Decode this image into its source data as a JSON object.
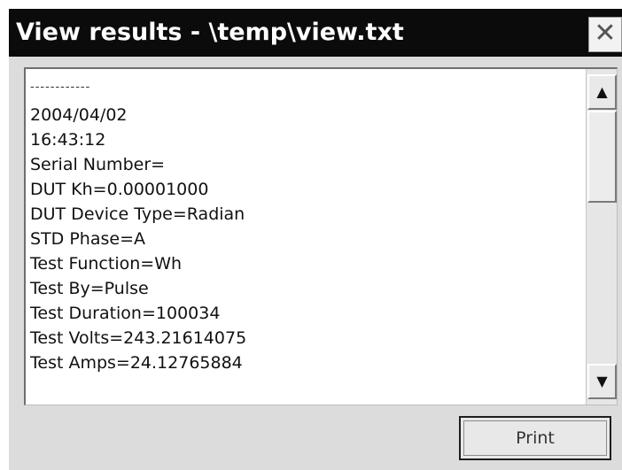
{
  "window": {
    "title": "View results - \\temp\\view.txt",
    "close_glyph": "✕"
  },
  "results": {
    "separator": "------------",
    "lines": [
      "2004/04/02",
      "16:43:12",
      "Serial Number=",
      "DUT Kh=0.00001000",
      "DUT Device Type=Radian",
      "STD Phase=A",
      "Test Function=Wh",
      "Test By=Pulse",
      "Test Duration=100034",
      "Test Volts=243.21614075",
      "Test Amps=24.12765884"
    ]
  },
  "scrollbar": {
    "up_glyph": "▲",
    "down_glyph": "▼",
    "up_icon": "arrow-up-icon",
    "down_icon": "arrow-down-icon"
  },
  "actions": {
    "print_label": "Print"
  },
  "colors": {
    "titlebar": "#0b0b0b",
    "title_text": "#ffffff",
    "window_bg": "#dcdcdc",
    "text_area_bg": "#ffffff"
  }
}
